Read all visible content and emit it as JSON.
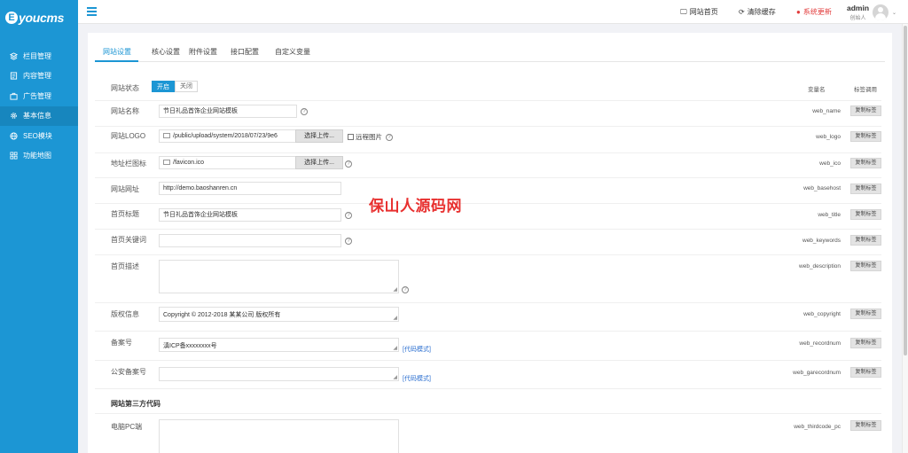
{
  "app": {
    "logo_letter": "E",
    "logo_text": "youcms"
  },
  "sidebar": {
    "items": [
      {
        "label": "栏目管理",
        "icon": "layers-icon"
      },
      {
        "label": "内容管理",
        "icon": "document-icon"
      },
      {
        "label": "广告管理",
        "icon": "briefcase-icon"
      },
      {
        "label": "基本信息",
        "icon": "gear-icon",
        "active": true
      },
      {
        "label": "SEO模块",
        "icon": "globe-icon"
      },
      {
        "label": "功能地图",
        "icon": "grid-icon"
      }
    ]
  },
  "topbar": {
    "home_label": "网站首页",
    "clear_cache_label": "清除缓存",
    "update_label": "系统更新",
    "admin_name": "admin",
    "admin_role": "创始人"
  },
  "tabs": [
    "网站设置",
    "核心设置",
    "附件设置",
    "接口配置",
    "自定义变量"
  ],
  "columns": {
    "var_name": "变量名",
    "tag_call": "标签调用"
  },
  "site_status": {
    "label": "网站状态",
    "on": "开启",
    "off": "关闭"
  },
  "copy_label": "复制标签",
  "upload_label": "选择上传...",
  "code_mode_label": "[代码模式]",
  "remote_image_label": "远程图片",
  "fields": {
    "web_name": {
      "label": "网站名称",
      "value": "节日礼品首饰企业网站模板",
      "var": "web_name"
    },
    "web_logo": {
      "label": "网站LOGO",
      "value": "/public/upload/system/2018/07/23/9e6",
      "var": "web_logo"
    },
    "web_ico": {
      "label": "地址栏图标",
      "value": "/favicon.ico",
      "var": "web_ico"
    },
    "web_basehost": {
      "label": "网站网址",
      "value": "http://demo.baoshanren.cn",
      "var": "web_basehost"
    },
    "web_title": {
      "label": "首页标题",
      "value": "节日礼品首饰企业网站模板",
      "var": "web_title"
    },
    "web_keywords": {
      "label": "首页关键词",
      "value": "",
      "var": "web_keywords"
    },
    "web_description": {
      "label": "首页描述",
      "value": "",
      "var": "web_description"
    },
    "web_copyright": {
      "label": "版权信息",
      "value": "Copyright © 2012-2018 某某公司 版权所有",
      "var": "web_copyright"
    },
    "web_recordnum": {
      "label": "备案号",
      "value": "滇ICP备xxxxxxxx号",
      "var": "web_recordnum"
    },
    "web_garecordnum": {
      "label": "公安备案号",
      "value": "",
      "var": "web_garecordnum"
    },
    "web_thirdcode_pc": {
      "label": "电脑PC端",
      "value": "",
      "var": "web_thirdcode_pc"
    }
  },
  "section_thirdparty": "网站第三方代码",
  "watermark": "保山人源码网",
  "colors": {
    "primary": "#1c96d4",
    "danger": "#e23c3c",
    "watermark": "#e8302f"
  }
}
